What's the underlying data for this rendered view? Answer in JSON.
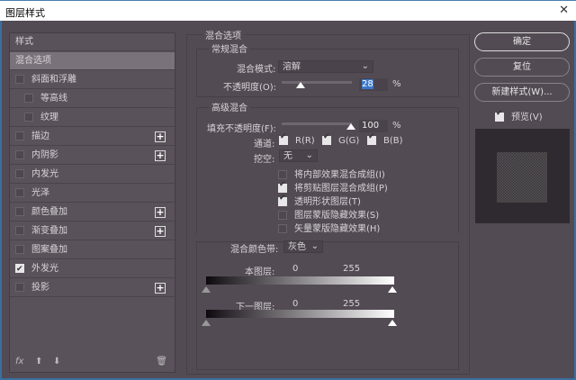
{
  "window": {
    "title": "图层样式",
    "close_icon": "close-icon"
  },
  "sidebar": {
    "header": "样式",
    "items": [
      {
        "label": "混合选项",
        "selected": true,
        "checkbox": false,
        "plus": false
      },
      {
        "label": "斜面和浮雕",
        "checked": false,
        "plus": false
      },
      {
        "label": "等高线",
        "checked": false,
        "plus": false,
        "indent": true
      },
      {
        "label": "纹理",
        "checked": false,
        "plus": false,
        "indent": true
      },
      {
        "label": "描边",
        "checked": false,
        "plus": true
      },
      {
        "label": "内阴影",
        "checked": false,
        "plus": true
      },
      {
        "label": "内发光",
        "checked": false,
        "plus": false
      },
      {
        "label": "光泽",
        "checked": false,
        "plus": false
      },
      {
        "label": "颜色叠加",
        "checked": false,
        "plus": true
      },
      {
        "label": "渐变叠加",
        "checked": false,
        "plus": true
      },
      {
        "label": "图案叠加",
        "checked": false,
        "plus": false
      },
      {
        "label": "外发光",
        "checked": true,
        "plus": false
      },
      {
        "label": "投影",
        "checked": false,
        "plus": true
      }
    ],
    "fx": "fx",
    "icons": [
      "fx-icon",
      "move-up-icon",
      "move-down-icon",
      "trash-icon"
    ]
  },
  "blend": {
    "title": "混合选项",
    "general": {
      "title": "常规混合",
      "mode_label": "混合模式:",
      "mode_value": "溶解",
      "opacity_label": "不透明度(O):",
      "opacity_value": "28",
      "unit": "%"
    },
    "advanced": {
      "title": "高级混合",
      "fill_label": "填充不透明度(F):",
      "fill_value": "100",
      "unit": "%",
      "channels_label": "通道:",
      "channels": [
        {
          "label": "R(R)",
          "checked": true
        },
        {
          "label": "G(G)",
          "checked": true
        },
        {
          "label": "B(B)",
          "checked": true
        }
      ],
      "knockout_label": "挖空:",
      "knockout_value": "无",
      "options": [
        {
          "label": "将内部效果混合成组(I)",
          "checked": false
        },
        {
          "label": "将剪贴图层混合成组(P)",
          "checked": true
        },
        {
          "label": "透明形状图层(T)",
          "checked": true
        },
        {
          "label": "图层蒙版隐藏效果(S)",
          "checked": false
        },
        {
          "label": "矢量蒙版隐藏效果(H)",
          "checked": false
        }
      ]
    },
    "blend_if": {
      "label": "混合颜色带:",
      "value": "灰色",
      "this_layer": "本图层:",
      "underlying": "下一图层:",
      "min": "0",
      "max": "255"
    }
  },
  "buttons": {
    "ok": "确定",
    "reset": "复位",
    "new_style": "新建样式(W)...",
    "preview": "预览(V)",
    "preview_checked": true
  }
}
